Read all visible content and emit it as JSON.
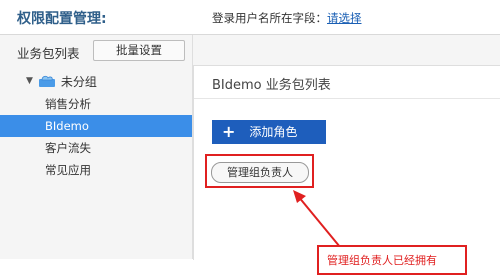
{
  "header": {
    "title": "权限配置管理:",
    "login_field_label": "登录用户名所在字段：",
    "login_field_link": "请选择"
  },
  "sidebar": {
    "title": "业务包列表",
    "batch_button": "批量设置",
    "group": {
      "label": "未分组",
      "icon": "cloud-folder-icon",
      "expanded": true
    },
    "items": [
      {
        "label": "销售分析",
        "active": false
      },
      {
        "label": "BIdemo",
        "active": true
      },
      {
        "label": "客户流失",
        "active": false
      },
      {
        "label": "常见应用",
        "active": false
      }
    ]
  },
  "main": {
    "panel_title": "BIdemo 业务包列表",
    "add_role_button": "添加角色",
    "role_chip": "管理组负责人"
  },
  "annotation": {
    "text": "管理组负责人已经拥有"
  },
  "colors": {
    "accent": "#1e5ebc",
    "active_item": "#3b8ee8",
    "annotation": "#e02020",
    "title": "#2f5f8a"
  }
}
